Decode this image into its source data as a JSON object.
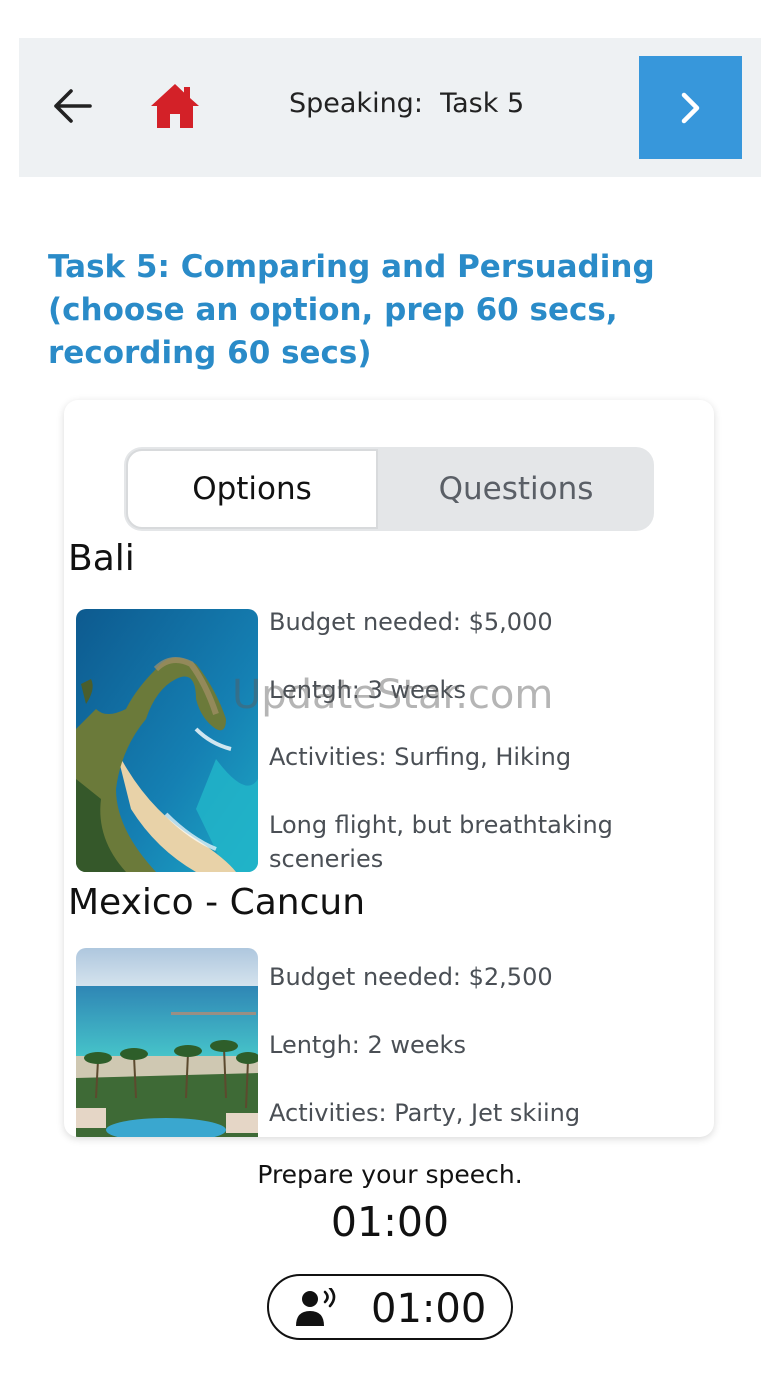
{
  "header": {
    "title": "Speaking:  Task 5",
    "back_icon": "arrow-left-icon",
    "home_icon": "home-icon",
    "next_icon": "chevron-right-icon",
    "home_color": "#d32128",
    "next_bg": "#3797db"
  },
  "task": {
    "heading": "Task 5: Comparing and Persuading (choose an option, prep 60 secs, recording 60 secs)",
    "heading_color": "#2a8bc8"
  },
  "tabs": {
    "options_label": "Options",
    "questions_label": "Questions",
    "selected": "Options"
  },
  "destinations": [
    {
      "title": "Bali",
      "budget": "Budget needed: $5,000",
      "length": "Lentgh: 3 weeks",
      "activities": "Activities: Surfing, Hiking",
      "note": "Long flight, but breathtaking sceneries"
    },
    {
      "title": "Mexico - Cancun",
      "budget": "Budget needed: $2,500",
      "length": "Lentgh: 2 weeks",
      "activities": "Activities: Party, Jet skiing"
    }
  ],
  "watermark": "UpdateStar.com",
  "footer": {
    "prepare_text": "Prepare your speech.",
    "prep_timer": "01:00",
    "record_timer": "01:00",
    "record_icon": "speaking-person-icon"
  }
}
